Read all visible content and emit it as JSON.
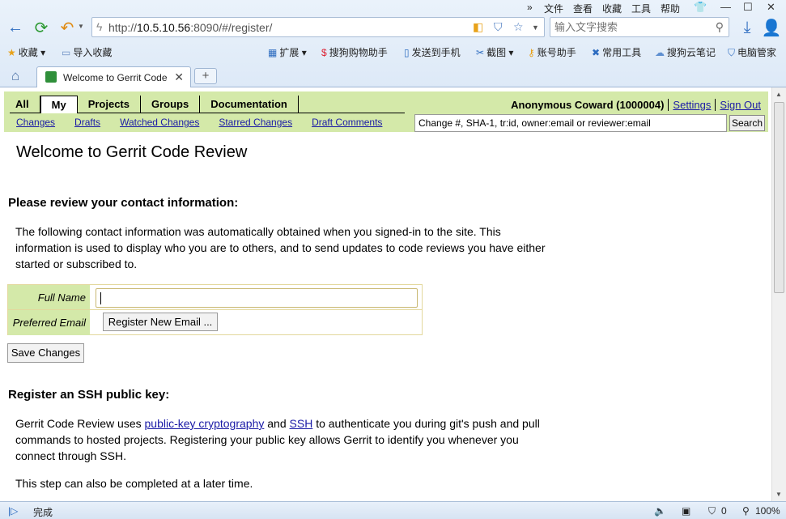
{
  "browser": {
    "menu": [
      "文件",
      "查看",
      "收藏",
      "工具",
      "帮助"
    ],
    "url_prefix": "http://",
    "url_host": "10.5.10.56",
    "url_rest": ":8090/#/register/",
    "search_placeholder": "输入文字搜索",
    "bookmarks": [
      "收藏",
      "导入收藏",
      "扩展",
      "搜狗购物助手",
      "发送到手机",
      "截图",
      "账号助手",
      "常用工具",
      "搜狗云笔记",
      "电脑管家"
    ],
    "tab_title": "Welcome to Gerrit Code Review",
    "status_text": "完成",
    "zoom": "100%",
    "counter": "0"
  },
  "gerrit": {
    "top_menu": [
      "All",
      "My",
      "Projects",
      "Groups",
      "Documentation"
    ],
    "active_menu": "My",
    "sub_menu": [
      "Changes",
      "Drafts",
      "Watched Changes",
      "Starred Changes",
      "Draft Comments"
    ],
    "user_name": "Anonymous Coward (1000004)",
    "settings_link": "Settings",
    "signout_link": "Sign Out",
    "search_value": "Change #, SHA-1, tr:id, owner:email or reviewer:email",
    "search_button": "Search"
  },
  "page": {
    "title": "Welcome to Gerrit Code Review",
    "contact_heading": "Please review your contact information:",
    "contact_text": "The following contact information was automatically obtained when you signed-in to the site. This information is used to display who you are to others, and to send updates to code reviews you have either started or subscribed to.",
    "full_name_label": "Full Name",
    "full_name_value": "",
    "preferred_email_label": "Preferred Email",
    "register_email_button": "Register New Email ...",
    "save_button": "Save Changes",
    "ssh_heading": "Register an SSH public key:",
    "ssh_text_1": "Gerrit Code Review uses",
    "ssh_link_1": "public-key cryptography",
    "ssh_text_2": "and",
    "ssh_link_2": "SSH",
    "ssh_text_3": "to authenticate you during git's push and pull commands to hosted projects. Registering your public key allows Gerrit to identify you whenever you connect through SSH.",
    "later_text": "This step can also be completed at a later time."
  },
  "colors": {
    "gerrit_header": "#d4e9a9",
    "link": "#1a1aa6"
  }
}
